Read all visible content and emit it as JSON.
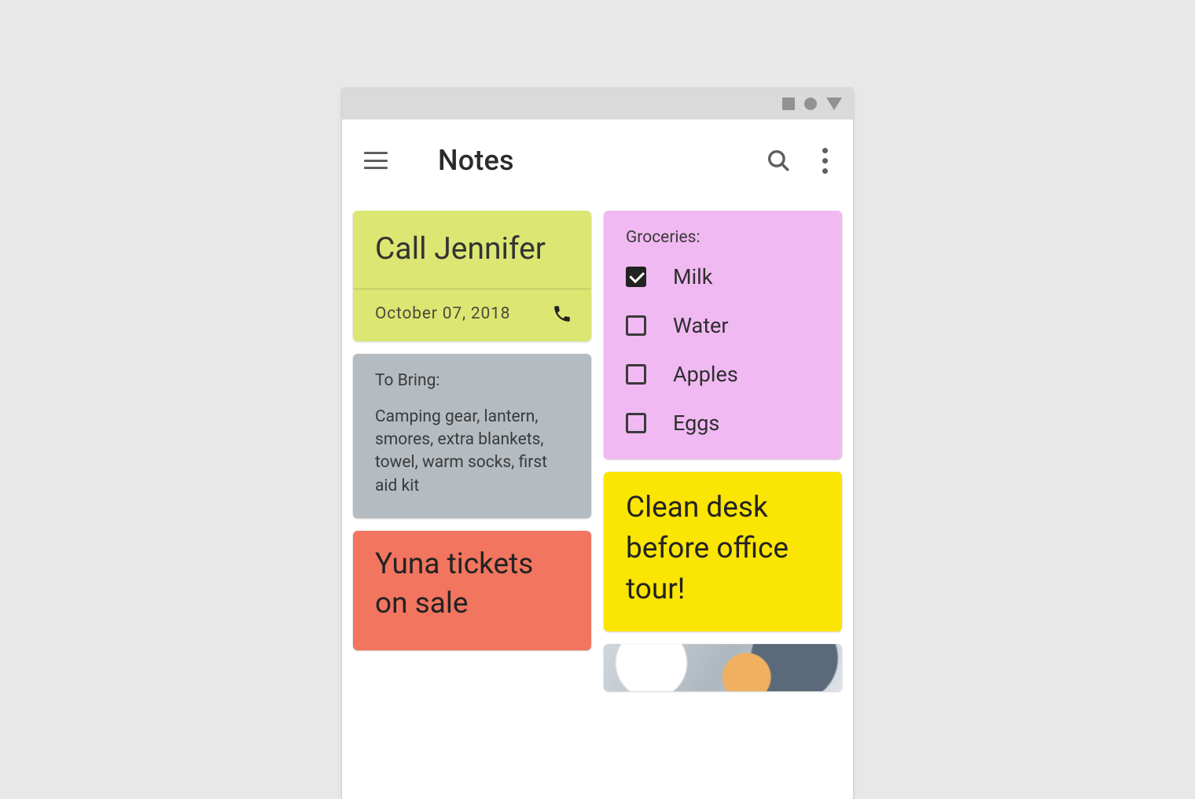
{
  "appbar": {
    "title": "Notes"
  },
  "notes": {
    "call": {
      "title": "Call Jennifer",
      "date": "October 07, 2018"
    },
    "bring": {
      "heading": "To Bring:",
      "body": "Camping gear, lantern, smores, extra blankets, towel, warm socks, first aid kit"
    },
    "tickets": {
      "title": "Yuna tickets on sale"
    },
    "groceries": {
      "heading": "Groceries:",
      "items": [
        {
          "label": "Milk",
          "checked": true
        },
        {
          "label": "Water",
          "checked": false
        },
        {
          "label": "Apples",
          "checked": false
        },
        {
          "label": "Eggs",
          "checked": false
        }
      ]
    },
    "clean": {
      "title": "Clean desk before office tour!"
    }
  },
  "colors": {
    "call": "#dbe772",
    "bring": "#b5bcc1",
    "tickets": "#f2755f",
    "groceries": "#f1b9f2",
    "clean": "#fbe502"
  }
}
